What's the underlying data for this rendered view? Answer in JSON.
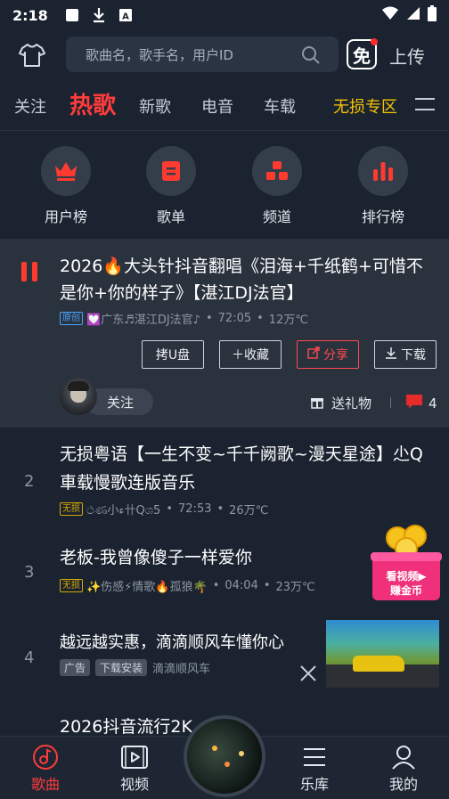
{
  "status_bar": {
    "time": "2:18"
  },
  "header": {
    "search_placeholder": "歌曲名，歌手名，用户ID",
    "mian_label": "免",
    "upload_label": "上传"
  },
  "tabs": [
    {
      "label": "关注"
    },
    {
      "label": "热歌"
    },
    {
      "label": "新歌"
    },
    {
      "label": "电音"
    },
    {
      "label": "车载"
    },
    {
      "label": "无损专区"
    }
  ],
  "categories": [
    {
      "label": "用户榜",
      "icon": "crown-icon"
    },
    {
      "label": "歌单",
      "icon": "playlist-icon"
    },
    {
      "label": "频道",
      "icon": "channel-icon"
    },
    {
      "label": "排行榜",
      "icon": "ranking-icon"
    }
  ],
  "now_playing": {
    "title": "2026🔥大头针抖音翻唱《泪海+千纸鹤+可惜不是你+你的样子》【湛江DJ法官】",
    "badge": "原创",
    "uploader": "💟广东♬湛江DJ法官♪",
    "duration": "72:05",
    "plays": "12万℃",
    "buttons": {
      "usb": "拷U盘",
      "collect": "＋收藏",
      "share": "分享",
      "download": "下载"
    },
    "follow_label": "关注",
    "gift_label": "送礼物",
    "comment_count": "4"
  },
  "songs": [
    {
      "rank": "2",
      "title": "无损粤语【一生不变~千千阙歌~漫天星途】尐Q車载慢歌连版音乐",
      "badge": "无损",
      "uploader": "ථණ小ء卄Qශ5",
      "duration": "72:53",
      "plays": "26万℃"
    },
    {
      "rank": "3",
      "title": "老板-我曾像傻子一样爱你",
      "badge": "无损",
      "uploader": "✨伤感⚡情歌🔥孤狼🌴",
      "duration": "04:04",
      "plays": "23万℃"
    },
    {
      "rank": "4",
      "title": "越远越实惠，滴滴顺风车懂你心",
      "ad_tag": "广告",
      "ad_download": "下载安装",
      "advertiser": "滴滴顺风车"
    },
    {
      "title": "2026抖音流行2K"
    }
  ],
  "promo": {
    "line1": "看视频▶",
    "line2": "赚金币"
  },
  "bottom_nav": [
    {
      "label": "歌曲"
    },
    {
      "label": "视频"
    },
    {
      "label": "乐库"
    },
    {
      "label": "我的"
    }
  ],
  "colors": {
    "accent": "#ff3b3b",
    "gold": "#f5c400",
    "background": "#1b2330",
    "card": "#2a323e"
  }
}
